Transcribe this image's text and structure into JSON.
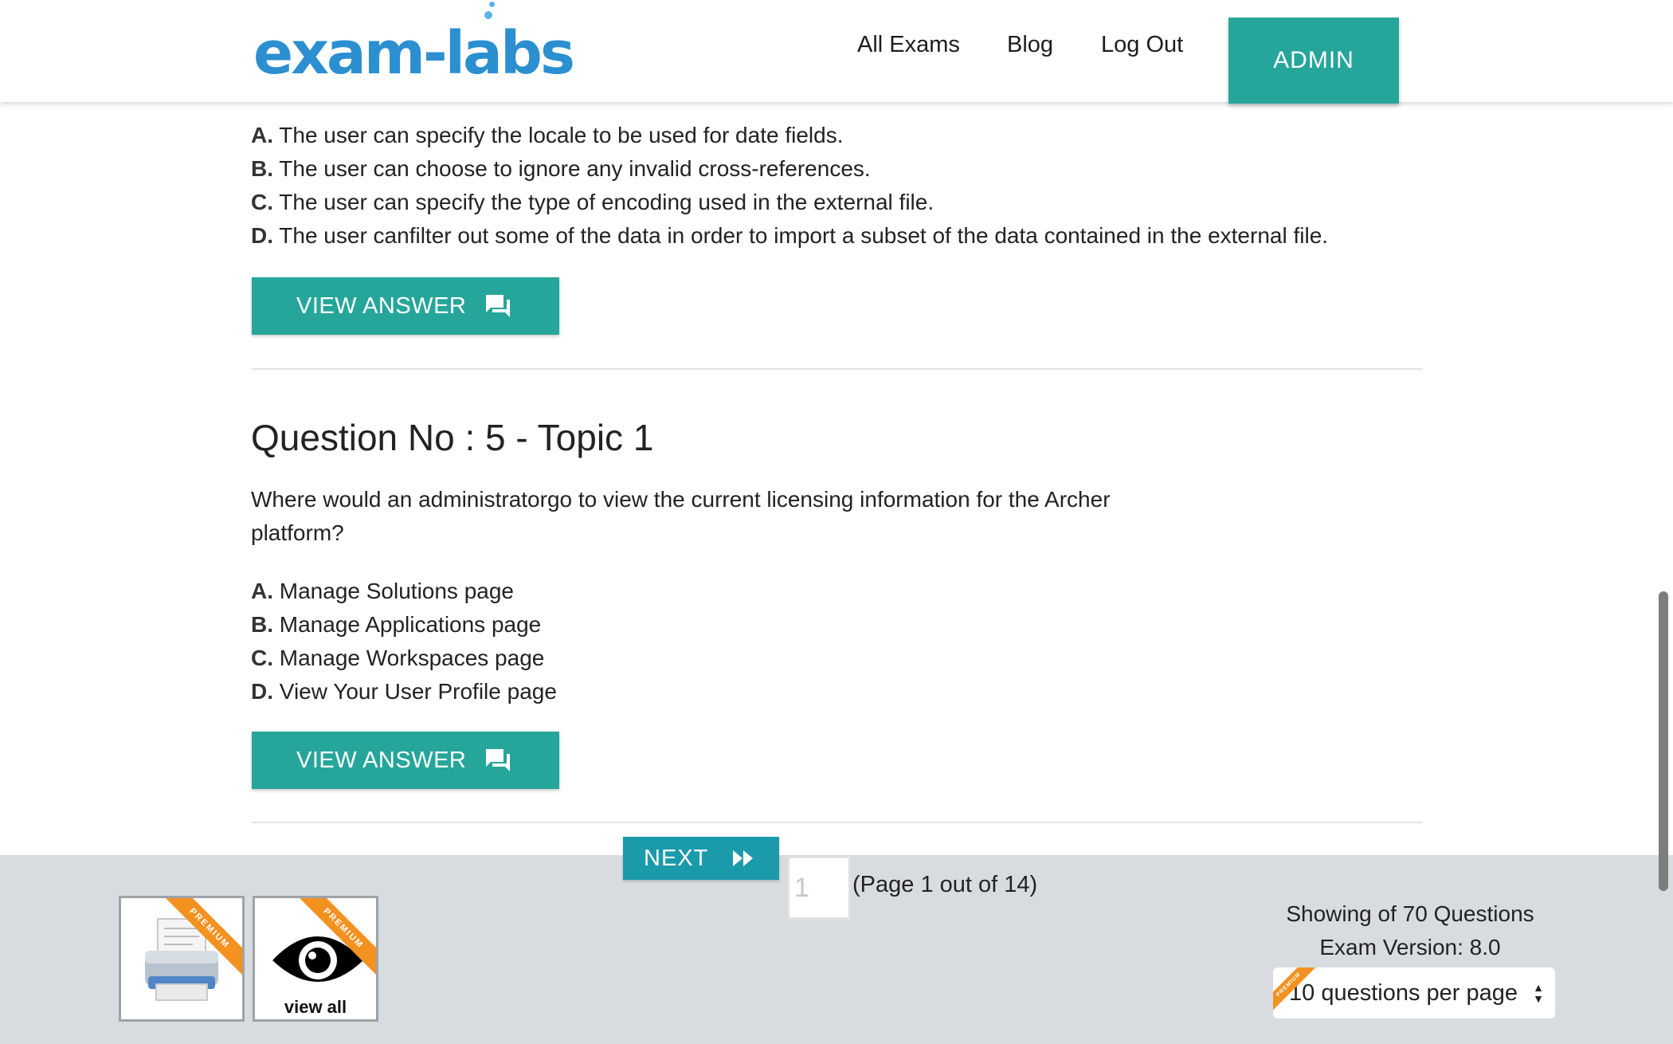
{
  "header": {
    "logo_text": "exam-labs",
    "nav": [
      "All Exams",
      "Blog",
      "Log Out"
    ],
    "admin_label": "ADMIN"
  },
  "question4": {
    "options": [
      {
        "letter": "A.",
        "text": "The user can specify the locale to be used for date fields."
      },
      {
        "letter": "B.",
        "text": "The user can choose to ignore any invalid cross-references."
      },
      {
        "letter": "C.",
        "text": "The user can specify the type of encoding used in the external file."
      },
      {
        "letter": "D.",
        "text": "The user canfilter out some of the data in order to import a subset of the data contained in the external file."
      }
    ],
    "view_answer_label": "VIEW ANSWER"
  },
  "question5": {
    "title": "Question No : 5 - Topic 1",
    "text": "Where would an administratorgo to view the current licensing information for the Archer platform?",
    "options": [
      {
        "letter": "A.",
        "text": "Manage Solutions page"
      },
      {
        "letter": "B.",
        "text": "Manage Applications page"
      },
      {
        "letter": "C.",
        "text": "Manage Workspaces page"
      },
      {
        "letter": "D.",
        "text": "View Your User Profile page"
      }
    ],
    "view_answer_label": "VIEW ANSWER"
  },
  "footer": {
    "next_label": "NEXT",
    "page_input_value": "1",
    "page_info": "(Page 1 out of 14)",
    "showing": "Showing of 70 Questions",
    "exam_version": "Exam Version: 8.0",
    "per_page": "10 questions per page",
    "view_all_label": "view all",
    "premium_label": "PREMIUM"
  },
  "colors": {
    "accent": "#26a69a",
    "next": "#1b9aaa",
    "logo": "#2b8fd0",
    "ribbon": "#f39121",
    "footer_bg": "#d8dce0"
  }
}
